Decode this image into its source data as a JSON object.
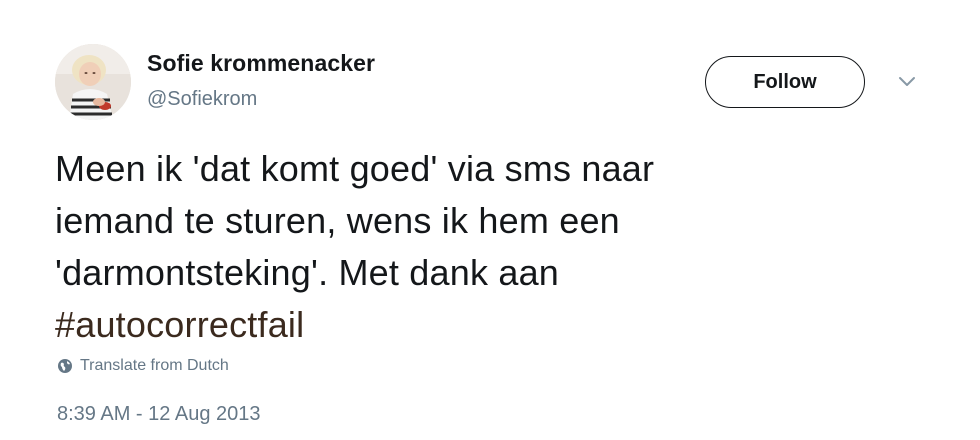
{
  "user": {
    "display_name": "Sofie krommenacker",
    "handle": "@Sofiekrom",
    "avatar_icon": "profile-photo"
  },
  "header": {
    "follow_label": "Follow",
    "menu_icon": "chevron-down-icon"
  },
  "tweet": {
    "lines": [
      "Meen ik 'dat komt goed' via sms naar",
      "iemand te sturen, wens ik hem een",
      "'darmontsteking'. Met dank aan"
    ],
    "hashtag": "#autocorrectfail",
    "translate_label": "Translate from Dutch",
    "timestamp": "8:39 AM - 12 Aug 2013"
  },
  "colors": {
    "text": "#14171a",
    "secondary": "#657786",
    "hashtag": "#3b2a1e"
  }
}
